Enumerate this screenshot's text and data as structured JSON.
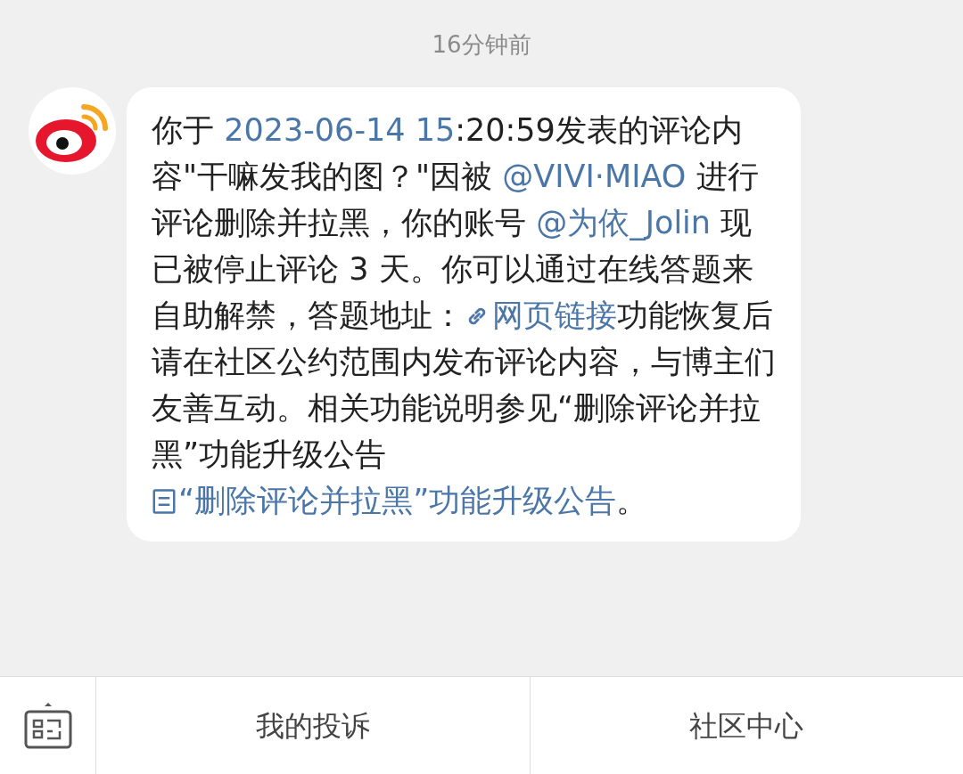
{
  "timestamp": "16分钟前",
  "message": {
    "segments": [
      {
        "kind": "text",
        "text": "你于 "
      },
      {
        "kind": "link",
        "text": "2023-06-14 15"
      },
      {
        "kind": "text",
        "text": ":20:59发表的评论内容\"干嘛发我的图？\"因被 "
      },
      {
        "kind": "link",
        "text": "@VIVI·MIAO"
      },
      {
        "kind": "text",
        "text": " 进行评论删除并拉黑，你的账号 "
      },
      {
        "kind": "link",
        "text": "@为依_Jolin"
      },
      {
        "kind": "text",
        "text": " 现已被停止评论 3 天。你可以通过在线答题来自助解禁，答题地址："
      },
      {
        "kind": "weblink",
        "text": "网页链接"
      },
      {
        "kind": "text",
        "text": "功能恢复后请在社区公约范围内发布评论内容，与博主们友善互动。相关功能说明参见“删除评论并拉黑”功能升级公告 "
      },
      {
        "kind": "doclink",
        "text": "“删除评论并拉黑”功能升级公告"
      },
      {
        "kind": "text",
        "text": "。"
      }
    ]
  },
  "bottom_bar": {
    "buttons": [
      "我的投诉",
      "社区中心"
    ]
  }
}
